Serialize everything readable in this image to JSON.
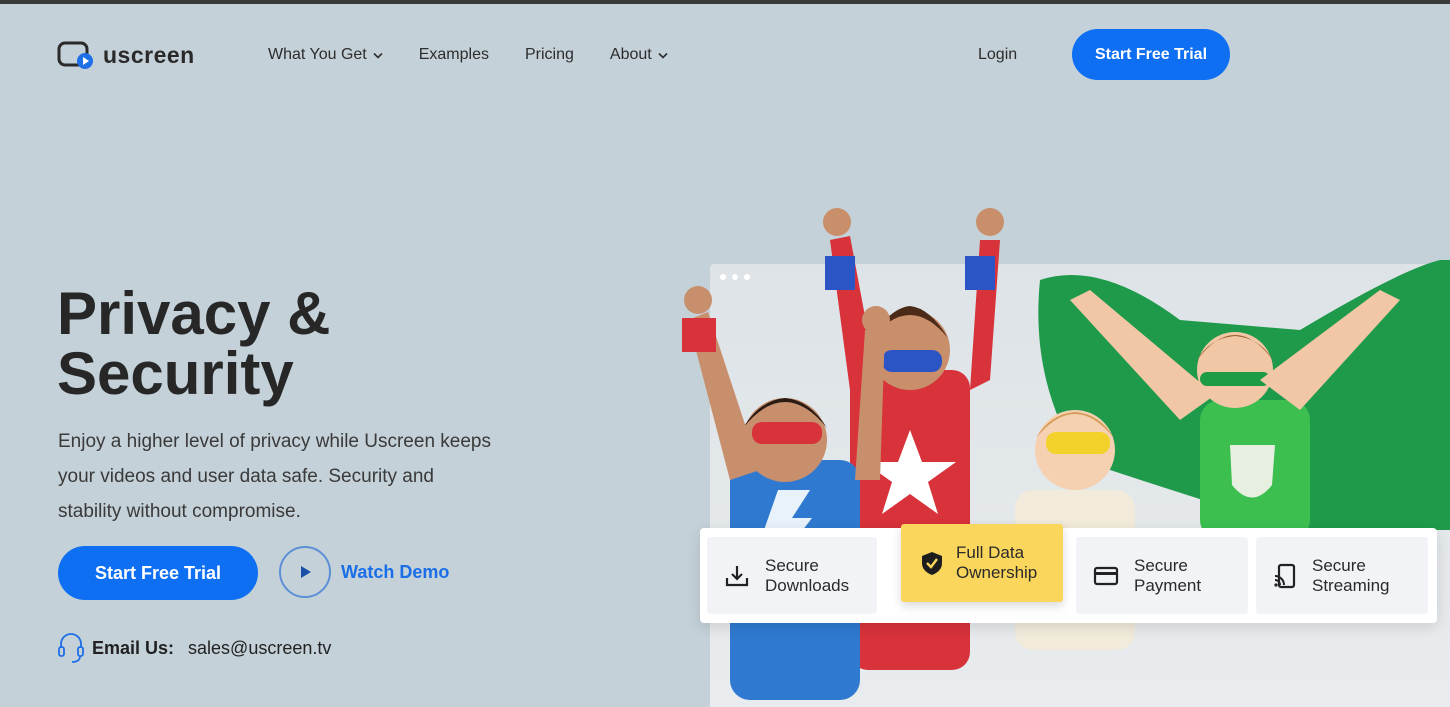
{
  "header": {
    "logo_text": "uscreen",
    "nav": [
      {
        "label": "What You Get",
        "has_dropdown": true
      },
      {
        "label": "Examples",
        "has_dropdown": false
      },
      {
        "label": "Pricing",
        "has_dropdown": false
      },
      {
        "label": "About",
        "has_dropdown": true
      }
    ],
    "login_label": "Login",
    "cta_label": "Start Free Trial"
  },
  "hero": {
    "title_line1": "Privacy &",
    "title_line2": "Security",
    "description": "Enjoy a higher level of privacy while Uscreen keeps your videos and user data safe. Security and stability without compromise.",
    "primary_cta": "Start Free Trial",
    "secondary_cta": "Watch Demo",
    "email_label": "Email Us:",
    "email_value": "sales@uscreen.tv"
  },
  "features": [
    {
      "line1": "Secure",
      "line2": "Downloads",
      "icon": "download-icon"
    },
    {
      "line1": "Full Data",
      "line2": "Ownership",
      "icon": "shield-check-icon",
      "highlighted": true
    },
    {
      "line1": "Secure",
      "line2": "Payment",
      "icon": "credit-card-icon"
    },
    {
      "line1": "Secure",
      "line2": "Streaming",
      "icon": "cast-icon"
    }
  ],
  "colors": {
    "accent": "#0f6ff3",
    "background": "#c4d1d8",
    "highlight": "#fbd65c"
  }
}
